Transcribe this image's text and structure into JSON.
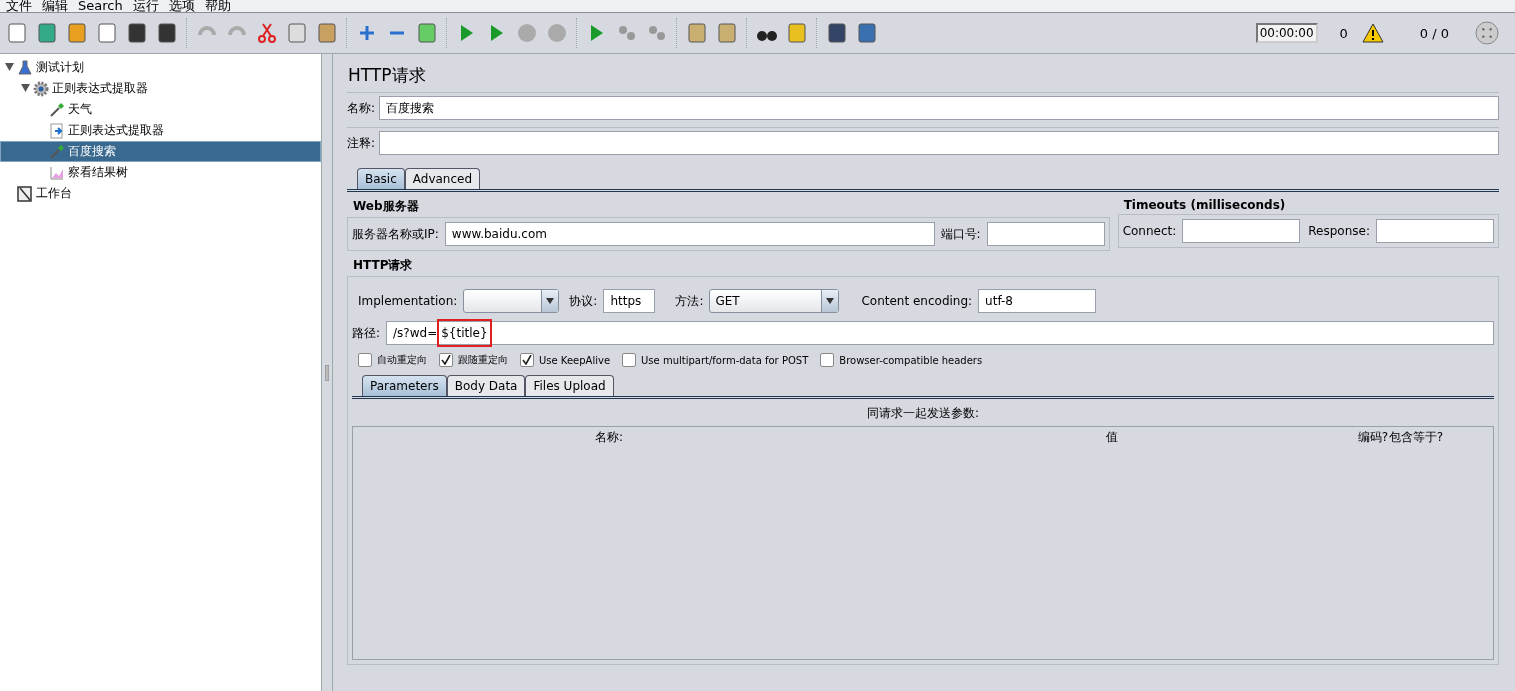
{
  "menu": [
    "文件",
    "编辑",
    "Search",
    "运行",
    "选项",
    "帮助"
  ],
  "status": {
    "timer": "00:00:00",
    "errors": "0",
    "threads": "0 / 0"
  },
  "tree": [
    {
      "label": "测试计划",
      "kind": "plan",
      "expanded": true,
      "selected": false,
      "children": [
        {
          "label": "正则表达式提取器",
          "kind": "gear",
          "expanded": true,
          "selected": false,
          "children": [
            {
              "label": "天气",
              "kind": "sampler",
              "selected": false
            },
            {
              "label": "正则表达式提取器",
              "kind": "extractor",
              "selected": false
            },
            {
              "label": "百度搜索",
              "kind": "sampler",
              "selected": true
            },
            {
              "label": "察看结果树",
              "kind": "listener",
              "selected": false
            }
          ]
        }
      ]
    },
    {
      "label": "工作台",
      "kind": "workbench",
      "selected": false
    }
  ],
  "panel": {
    "title": "HTTP请求",
    "name_label": "名称:",
    "name_value": "百度搜索",
    "comment_label": "注释:",
    "tabs": [
      {
        "label": "Basic",
        "selected": true
      },
      {
        "label": "Advanced",
        "selected": false
      }
    ],
    "web_server": {
      "heading": "Web服务器",
      "server_label": "服务器名称或IP:",
      "server_value": "www.baidu.com",
      "port_label": "端口号:"
    },
    "timeouts": {
      "heading": "Timeouts (milliseconds)",
      "connect_label": "Connect:",
      "response_label": "Response:"
    },
    "http": {
      "heading": "HTTP请求",
      "implementation_label": "Implementation:",
      "protocol_label": "协议:",
      "protocol_value": "https",
      "method_label": "方法:",
      "method_value": "GET",
      "encoding_label": "Content encoding:",
      "encoding_value": "utf-8",
      "path_label": "路径:",
      "path_prefix": "/s?wd=",
      "path_highlight": "${title}",
      "options": [
        {
          "label": "自动重定向",
          "checked": false
        },
        {
          "label": "跟随重定向",
          "checked": true
        },
        {
          "label": "Use KeepAlive",
          "checked": true
        },
        {
          "label": "Use multipart/form-data for POST",
          "checked": false
        },
        {
          "label": "Browser-compatible headers",
          "checked": false
        }
      ]
    },
    "sub_tabs": [
      {
        "label": "Parameters",
        "selected": true
      },
      {
        "label": "Body Data",
        "selected": false
      },
      {
        "label": "Files Upload",
        "selected": false
      }
    ],
    "params_caption": "同请求一起发送参数:",
    "columns": [
      "名称:",
      "值",
      "编码?",
      "包含等于?"
    ]
  }
}
